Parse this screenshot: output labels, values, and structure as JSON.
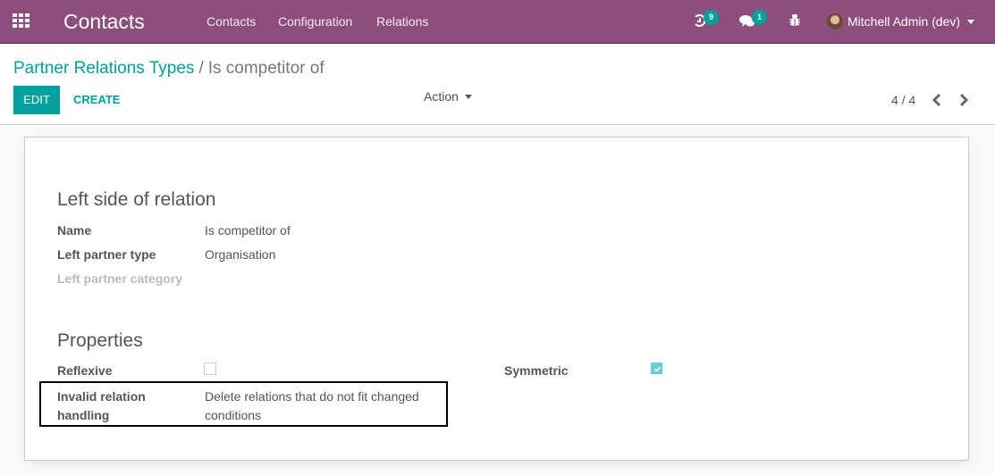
{
  "navbar": {
    "app_title": "Contacts",
    "menu": [
      "Contacts",
      "Configuration",
      "Relations"
    ],
    "activity_badge": "9",
    "messages_badge": "1",
    "user_name": "Mitchell Admin (dev)",
    "icons": {
      "apps": "apps-grid-icon",
      "activity": "clock-icon",
      "messages": "chat-icon",
      "debug": "bug-icon"
    }
  },
  "control_panel": {
    "breadcrumb_parent": "Partner Relations Types",
    "breadcrumb_separator": "/",
    "breadcrumb_current": "Is competitor of",
    "edit_label": "EDIT",
    "create_label": "CREATE",
    "action_label": "Action",
    "pager": "4 / 4"
  },
  "form": {
    "left_side": {
      "title": "Left side of relation",
      "fields": [
        {
          "label": "Name",
          "value": "Is competitor of"
        },
        {
          "label": "Left partner type",
          "value": "Organisation"
        },
        {
          "label": "Left partner category",
          "value": ""
        }
      ]
    },
    "properties": {
      "title": "Properties",
      "reflexive_label": "Reflexive",
      "reflexive_checked": false,
      "symmetric_label": "Symmetric",
      "symmetric_checked": true,
      "invalid_handling_label_line1": "Invalid relation",
      "invalid_handling_label_line2": "handling",
      "invalid_handling_value_line1": "Delete relations that do not fit changed",
      "invalid_handling_value_line2": "conditions"
    }
  },
  "colors": {
    "navbar": "#8e4e7c",
    "accent": "#00a09d",
    "checkbox_checked": "#66d1cc"
  }
}
